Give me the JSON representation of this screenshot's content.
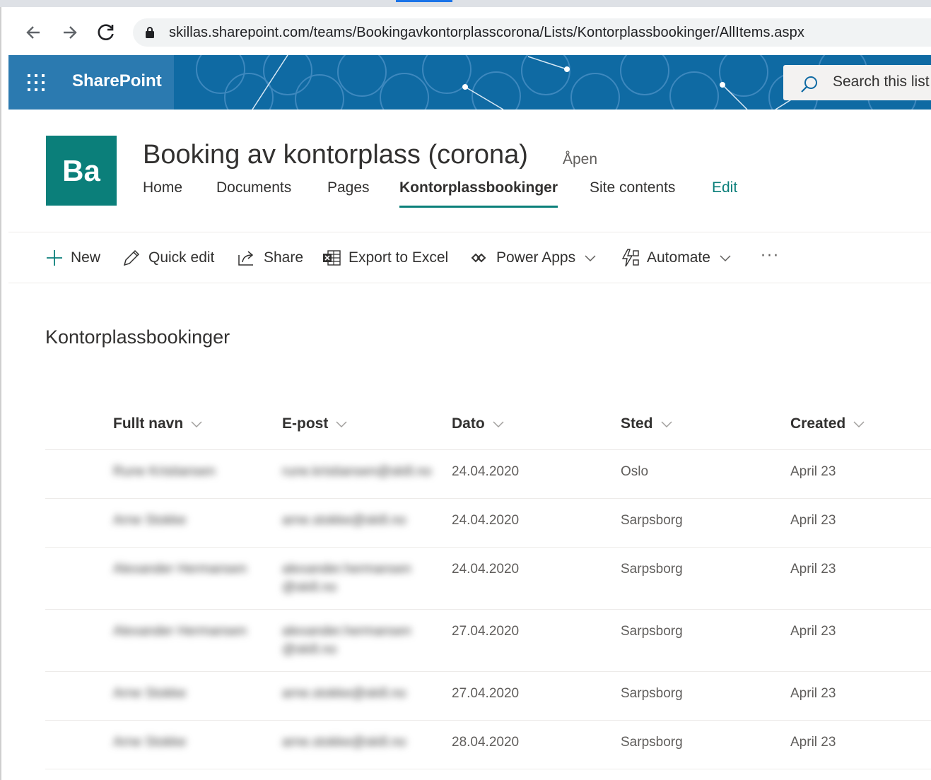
{
  "browser": {
    "url": "skillas.sharepoint.com/teams/Bookingavkontorplasscorona/Lists/Kontorplassbookinger/AllItems.aspx"
  },
  "suite": {
    "app_name": "SharePoint",
    "search_placeholder": "Search this list"
  },
  "site": {
    "logo_text": "Ba",
    "title": "Booking av kontorplass (corona)",
    "privacy": "Åpen",
    "nav": [
      "Home",
      "Documents",
      "Pages",
      "Kontorplassbookinger",
      "Site contents",
      "Edit"
    ],
    "active_nav": "Kontorplassbookinger"
  },
  "commands": {
    "new": "New",
    "quick_edit": "Quick edit",
    "share": "Share",
    "export": "Export to Excel",
    "power_apps": "Power Apps",
    "automate": "Automate",
    "more": "···"
  },
  "list": {
    "title": "Kontorplassbookinger",
    "columns": [
      "Fullt navn",
      "E-post",
      "Dato",
      "Sted",
      "Created"
    ],
    "rows": [
      {
        "name": "Rune Kristiansen",
        "email": "rune.kristiansen@skill.no",
        "date": "24.04.2020",
        "place": "Oslo",
        "created": "April 23"
      },
      {
        "name": "Arne Stokke",
        "email": "arne.stokke@skill.no",
        "date": "24.04.2020",
        "place": "Sarpsborg",
        "created": "April 23"
      },
      {
        "name": "Alexander Hermansen",
        "email": "alexander.hermansen",
        "email2": "@skill.no",
        "date": "24.04.2020",
        "place": "Sarpsborg",
        "created": "April 23"
      },
      {
        "name": "Alexander Hermansen",
        "email": "alexander.hermansen",
        "email2": "@skill.no",
        "date": "27.04.2020",
        "place": "Sarpsborg",
        "created": "April 23"
      },
      {
        "name": "Arne Stokke",
        "email": "arne.stokke@skill.no",
        "date": "27.04.2020",
        "place": "Sarpsborg",
        "created": "April 23"
      },
      {
        "name": "Arne Stokke",
        "email": "arne.stokke@skill.no",
        "date": "28.04.2020",
        "place": "Sarpsborg",
        "created": "April 23"
      }
    ]
  }
}
